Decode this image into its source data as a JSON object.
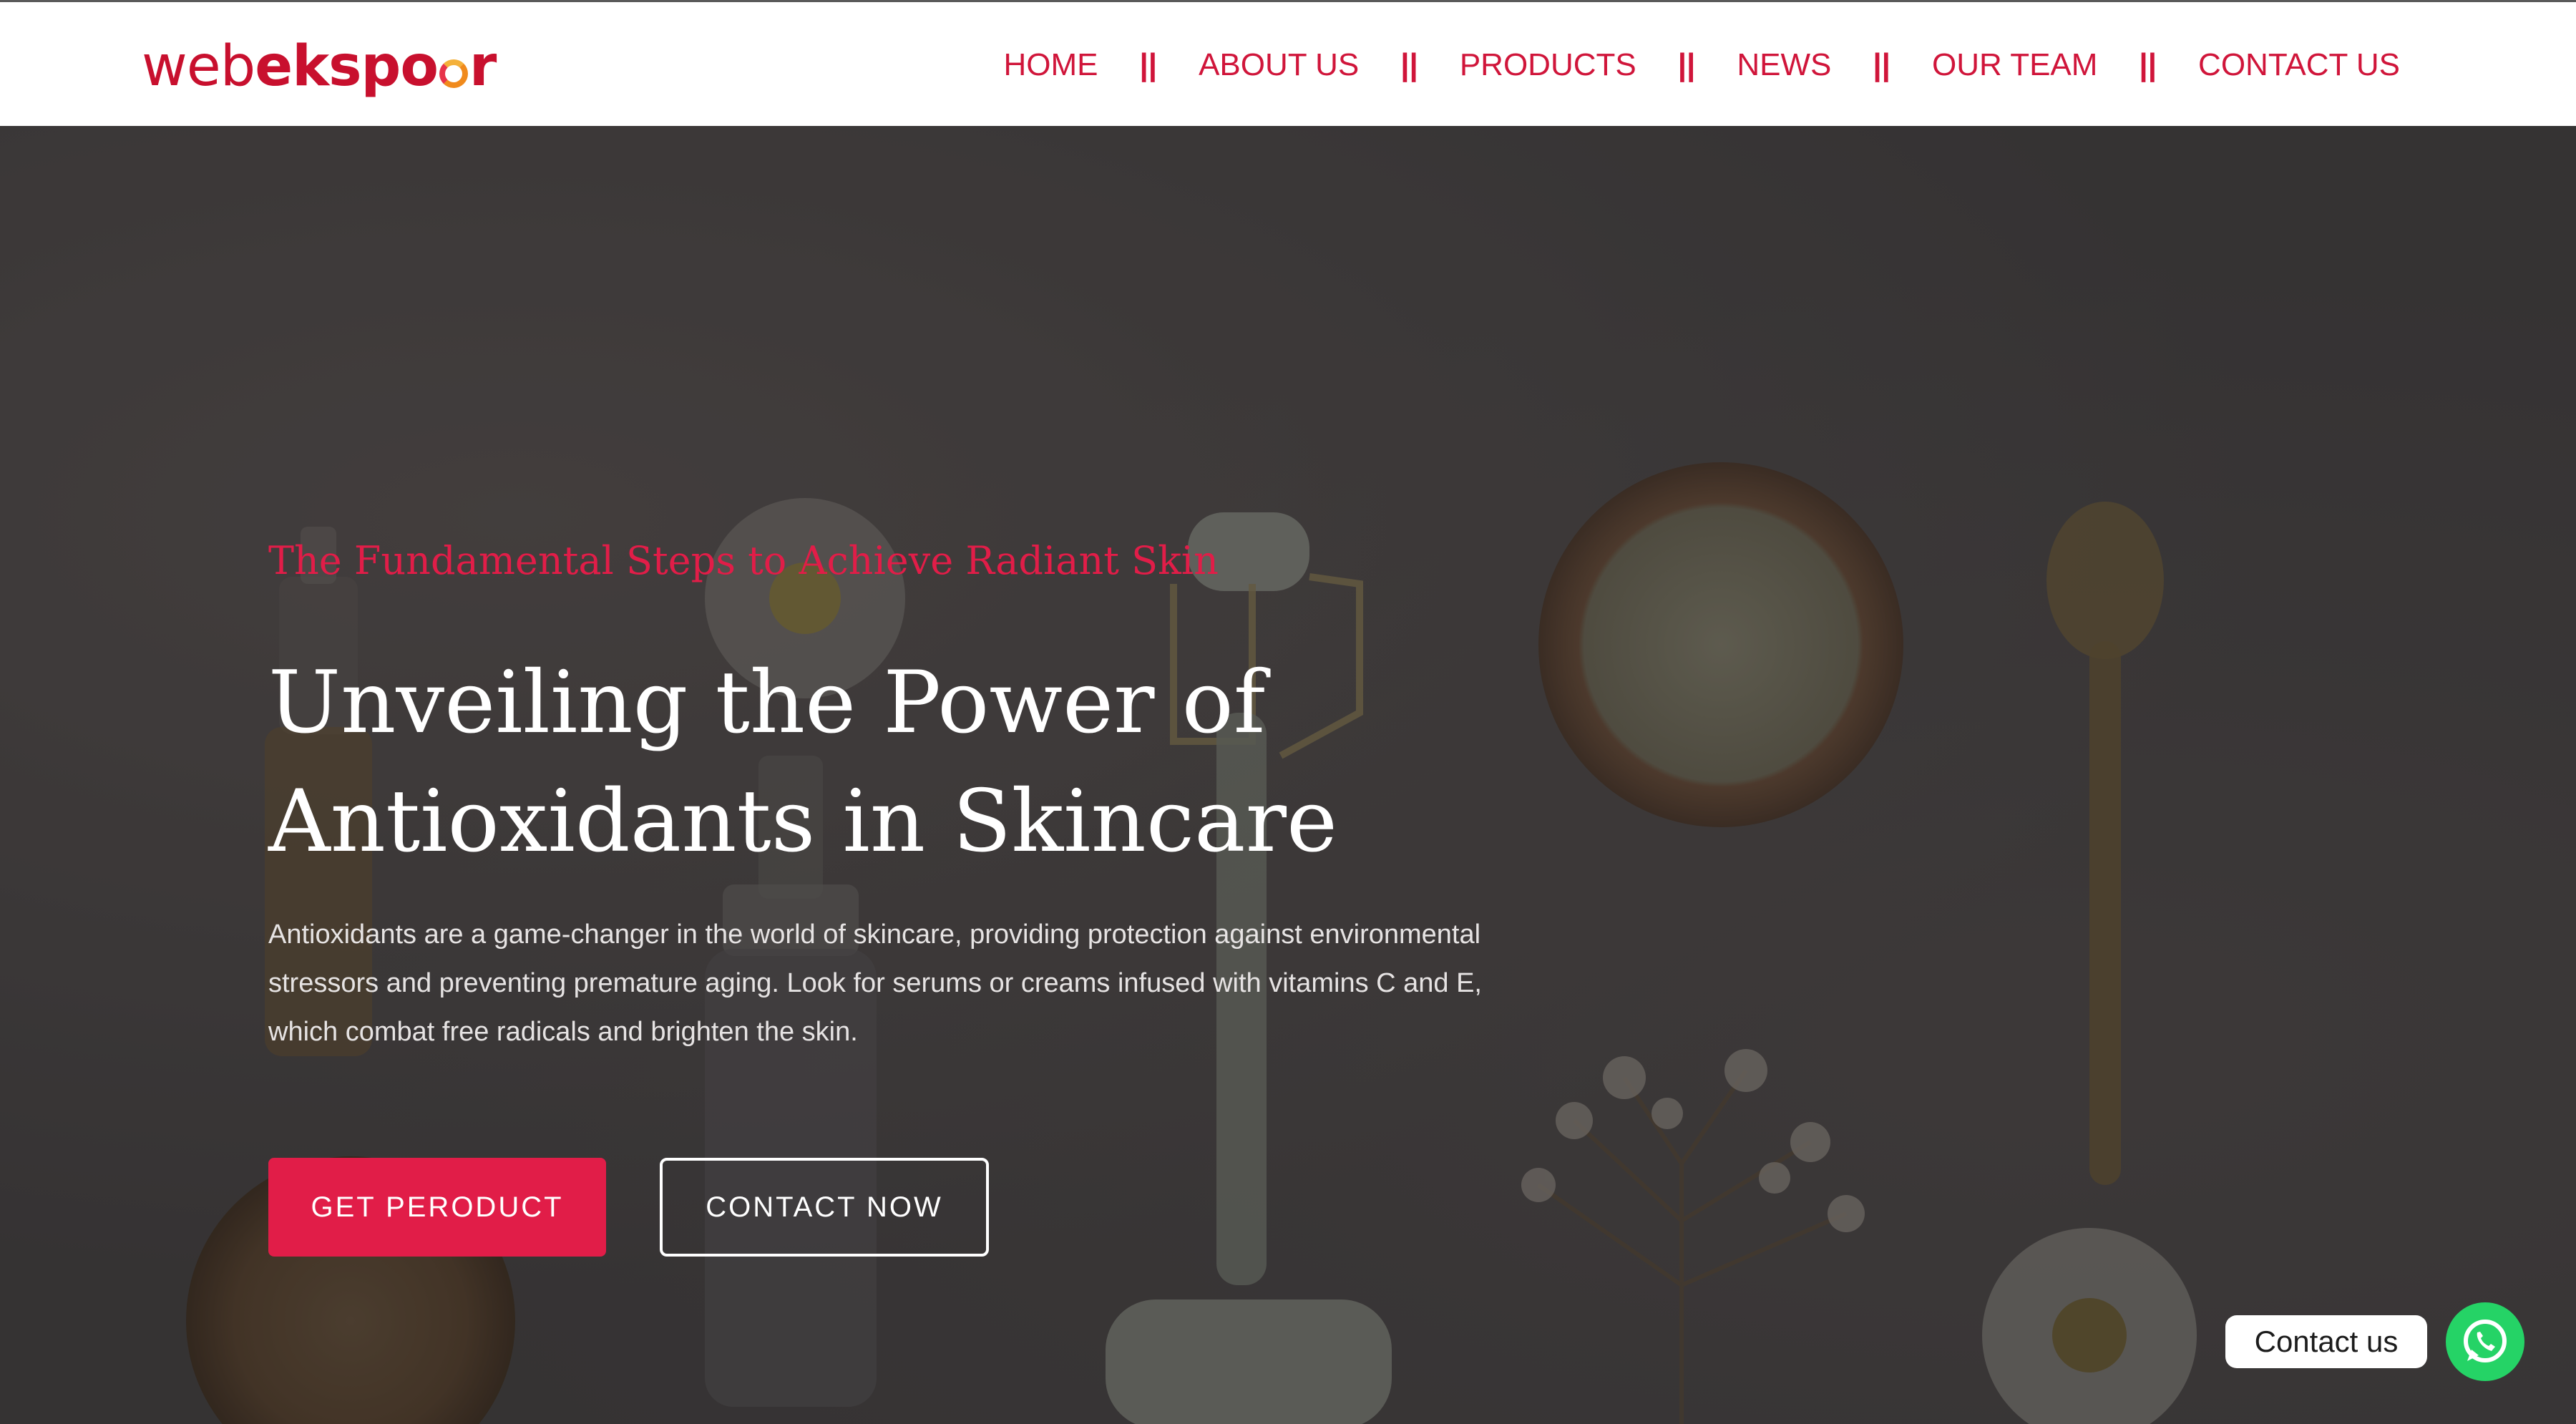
{
  "header": {
    "logo": {
      "part1": "web",
      "part2": "ekspo",
      "part3": "r"
    },
    "nav": [
      {
        "label": "HOME"
      },
      {
        "label": "ABOUT US"
      },
      {
        "label": "PRODUCTS"
      },
      {
        "label": "NEWS"
      },
      {
        "label": "OUR TEAM"
      },
      {
        "label": "CONTACT US"
      }
    ],
    "separator": "||"
  },
  "hero": {
    "subtitle": "The Fundamental Steps to Achieve Radiant Skin",
    "title_line1": "Unveiling the Power of",
    "title_line2": "Antioxidants in Skincare",
    "description": "Antioxidants are a game-changer in the world of skincare, providing protection against environmental stressors and preventing premature aging. Look for serums or creams infused with vitamins C and E, which combat free radicals and brighten the skin.",
    "primary_button": "GET PERODUCT",
    "secondary_button": "CONTACT NOW"
  },
  "widget": {
    "contact_label": "Contact us",
    "icon": "whatsapp-icon"
  },
  "colors": {
    "brand": "#d0153a",
    "accent_button": "#e11d48",
    "hero_background": "#433f40",
    "whatsapp": "#25d366"
  }
}
